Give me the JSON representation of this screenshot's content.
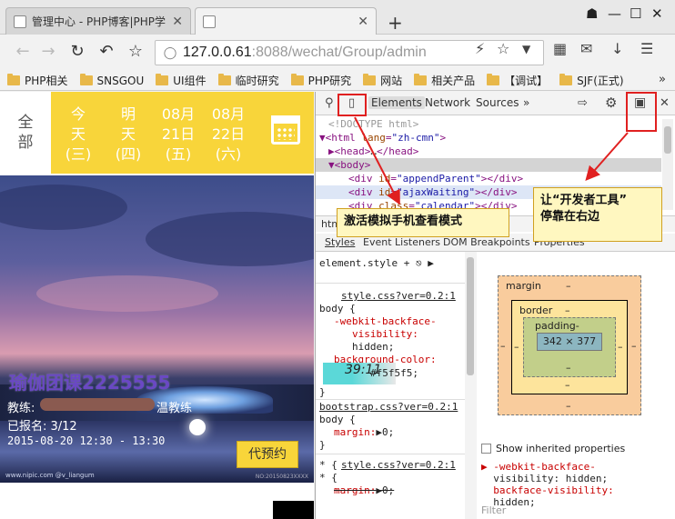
{
  "browser": {
    "tabs": [
      {
        "title": "管理中心 - PHP博客|PHP学",
        "active": false
      },
      {
        "title": "",
        "active": true
      }
    ],
    "new_tab_label": "+",
    "window_controls": {
      "user": "☗",
      "minimize": "—",
      "maximize": "☐",
      "close": "✕"
    },
    "url_host": "127.0.0.61",
    "url_rest": ":8088/wechat/Group/admin",
    "bookmarks": [
      "PHP相关",
      "SNSGOU",
      "UI组件",
      "临时研究",
      "PHP研究",
      "网站",
      "相关产品",
      "【调试】",
      "SJF(正式)"
    ],
    "bookmarks_more": "»"
  },
  "page": {
    "all_label": "全部",
    "days": [
      {
        "line1": "今",
        "line2": "天",
        "line3": "(三)"
      },
      {
        "line1": "明",
        "line2": "天",
        "line3": "(四)"
      },
      {
        "line1": "08月",
        "line2": "21日",
        "line3": "(五)"
      },
      {
        "line1": "08月",
        "line2": "22日",
        "line3": "(六)"
      }
    ],
    "course_title": "瑜伽团课2225555",
    "coach_prefix": "教练:",
    "coach_suffix": "温教练",
    "enrolled": "已报名: 3/12",
    "time": "2015-08-20 12:30 - 13:30",
    "book_button": "代预约",
    "watermark_left": "www.nipic.com  @v_liangum",
    "watermark_right": "NO:20150823XXXX"
  },
  "devtools": {
    "tabs": [
      "Elements",
      "Network",
      "Sources"
    ],
    "more": "»",
    "dom_lines": [
      {
        "indent": 0,
        "html": "<!DOCTYPE html>"
      },
      {
        "indent": 0,
        "html": "<html lang=\"zh-cmn\">"
      },
      {
        "indent": 1,
        "html": "<head>…</head>"
      },
      {
        "indent": 1,
        "html": "<body>"
      },
      {
        "indent": 2,
        "html": "<div id=\"appendParent\"></div>"
      },
      {
        "indent": 2,
        "html": "<div id=\"ajaxWaiting\"></div>"
      },
      {
        "indent": 2,
        "html": "<div class=\"calendar\"></div>"
      }
    ],
    "breadcrumb": "html",
    "subtabs": [
      "Styles",
      "Event Listeners",
      "DOM Breakpoints",
      "Properties"
    ],
    "styles": {
      "element_style": "element.style",
      "rule1_source": "style.css?ver=0.2:1",
      "rule1_selector": "body {",
      "rule1_p1": "-webkit-backface-",
      "rule1_p1b": "visibility:",
      "rule1_v1": "hidden;",
      "rule1_p2": "background-color:",
      "rule1_v2": "#f5f5f5;",
      "swatch_text": "39:11",
      "rule2_source": "bootstrap.css?ver=0.2:1",
      "rule2_selector": "body {",
      "rule2_p1": "margin:",
      "rule2_v1": "▶0;",
      "rule3_source": "style.css?ver=0.2:1",
      "rule3_selector": "* {",
      "rule3_p1": "margin:",
      "rule3_v1": "▶0;"
    },
    "box_model": {
      "margin_label": "margin",
      "border_label": "border",
      "padding_label": "padding-",
      "content": "342 × 377",
      "dash": "–"
    },
    "show_inherited": "Show inherited properties",
    "computed": [
      "▶ -webkit-backface-",
      "  visibility: hidden;",
      "  backface-visibility:",
      "  hidden;"
    ],
    "filter_placeholder": "Filter"
  },
  "annotations": {
    "mobile_mode": "激活模拟手机查看模式",
    "dock_right": "让“开发者工具”\n停靠在右边"
  },
  "colors": {
    "accent_yellow": "#f8d53a",
    "annotation_red": "#e02020",
    "callout_bg": "#fff7c0"
  }
}
